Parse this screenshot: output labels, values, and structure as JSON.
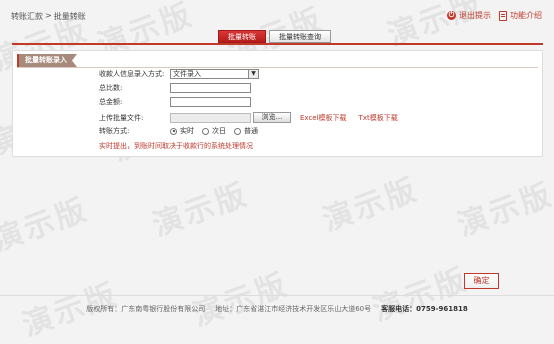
{
  "breadcrumb": {
    "parent": "转账汇款",
    "separator": ">",
    "current": "批量转账"
  },
  "top_links": {
    "logout": "退出提示",
    "help": "功能介绍"
  },
  "tabs": [
    {
      "label": "批量转账",
      "active": true
    },
    {
      "label": "批量转账查询",
      "active": false
    }
  ],
  "panel": {
    "title": "批量转账录入",
    "payee_mode": {
      "label": "收款人信息录入方式:",
      "value": "文件录入"
    },
    "total_count": {
      "label": "总比数:",
      "value": ""
    },
    "total_amount": {
      "label": "总金额:",
      "value": ""
    },
    "upload": {
      "label": "上传批量文件:",
      "value": "",
      "browse": "浏览...",
      "excel_link": "Excel模板下载",
      "txt_link": "Txt模板下载"
    },
    "transfer_mode": {
      "label": "转账方式:",
      "options": [
        {
          "label": "实时",
          "selected": true
        },
        {
          "label": "次日",
          "selected": false
        },
        {
          "label": "普通",
          "selected": false
        }
      ]
    },
    "hint": "实时提出，到账时间取决于收款行的系统处理情况"
  },
  "confirm_label": "确定",
  "footer": {
    "copyright": "版权所有：广东南粤银行股份有限公司",
    "address": "地址：广东省湛江市经济技术开发区乐山大道60号",
    "phone": "客服电话：0759-961818"
  },
  "watermark": "演示版",
  "colors": {
    "accent": "#c0392b",
    "panel_title_bg": "#a88a7c"
  }
}
